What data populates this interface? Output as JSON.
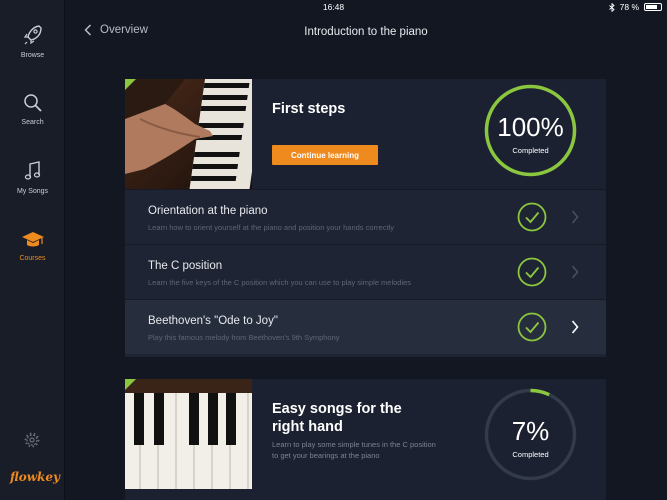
{
  "status_bar": {
    "device": "iPad",
    "time": "16:48",
    "battery": "78 %",
    "battery_level": 0.78
  },
  "sidebar": {
    "items": [
      {
        "label": "Browse",
        "icon": "rocket-icon"
      },
      {
        "label": "Search",
        "icon": "search-icon"
      },
      {
        "label": "My Songs",
        "icon": "music-note-icon"
      },
      {
        "label": "Courses",
        "icon": "graduation-cap-icon",
        "active": true
      }
    ],
    "settings_icon": "gear-icon",
    "logo": "flowkey"
  },
  "nav": {
    "back_label": "Overview",
    "title": "Introduction to the piano"
  },
  "accent_color": "#ef8a1f",
  "progress_color": "#8bc63f",
  "courses": [
    {
      "title": "First steps",
      "button_label": "Continue learning",
      "progress_text": "100%",
      "progress_value": 1.0,
      "progress_label": "Completed",
      "lessons": [
        {
          "title": "Orientation at the piano",
          "subtitle": "Learn how to orient yourself at the piano and position your hands correctly",
          "completed": true
        },
        {
          "title": "The C position",
          "subtitle": "Learn the five keys of the C position which you can use to play simple melodies",
          "completed": true
        },
        {
          "title": "Beethoven's \"Ode to Joy\"",
          "subtitle": "Play this famous melody from Beethoven's 9th Symphony",
          "completed": true,
          "current": true
        }
      ]
    },
    {
      "title": "Easy songs for the right hand",
      "description": "Learn to play some simple tunes in the C position to get your bearings at the piano",
      "progress_text": "7%",
      "progress_value": 0.07,
      "progress_label": "Completed"
    }
  ]
}
